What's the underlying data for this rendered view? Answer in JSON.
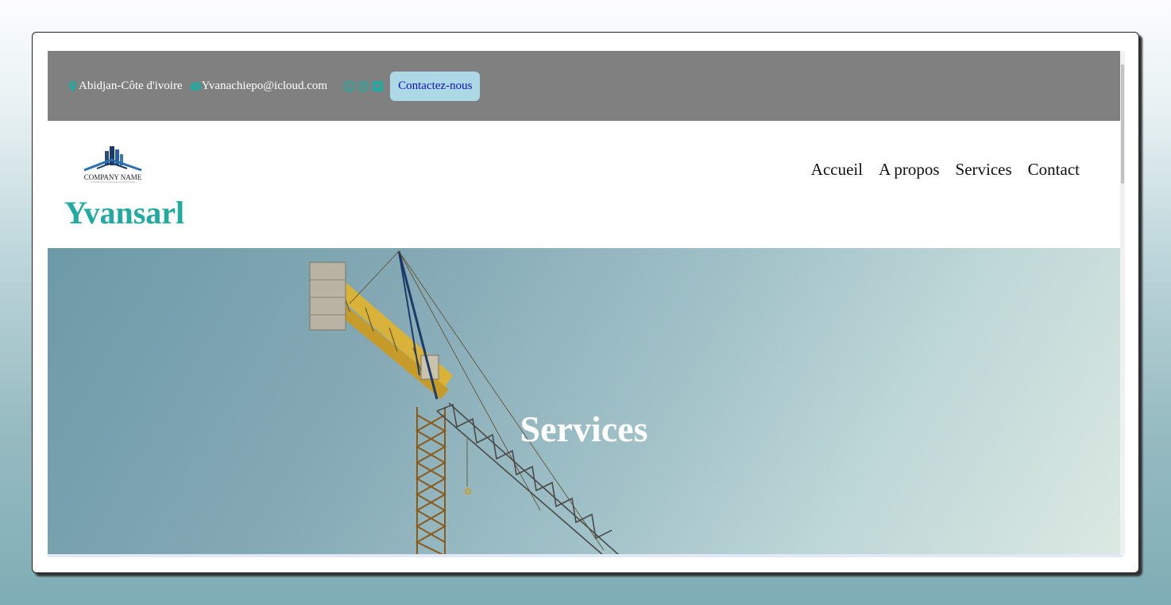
{
  "topbar": {
    "location": "Abidjan-Côte d'ivoire",
    "email": "Yvanachiepo@icloud.com",
    "contact_button": "Contactez-nous",
    "icons": [
      "location-pin-icon",
      "envelope-icon",
      "facebook-icon",
      "instagram-icon",
      "twitter-icon"
    ],
    "background_color": "#808080",
    "icon_color": "#20aaa0"
  },
  "header": {
    "logo_text": "COMPANY NAME",
    "brand": "Yvansarl",
    "brand_color": "#20aaa0"
  },
  "nav": {
    "items": [
      "Accueil",
      "A propos",
      "Services",
      "Contact"
    ]
  },
  "hero": {
    "title": "Services"
  }
}
